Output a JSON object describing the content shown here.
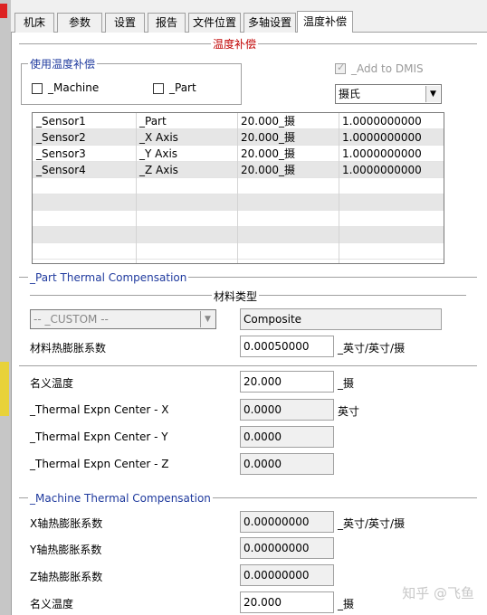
{
  "tabs": [
    {
      "label": "机床"
    },
    {
      "label": "参数"
    },
    {
      "label": "设置"
    },
    {
      "label": "报告"
    },
    {
      "label": "文件位置"
    },
    {
      "label": "多轴设置"
    },
    {
      "label": "温度补偿",
      "active": true
    }
  ],
  "header": {
    "title": "温度补偿"
  },
  "use_comp": {
    "title": "使用温度补偿",
    "machine_label": "_Machine",
    "part_label": "_Part",
    "machine_checked": false,
    "part_checked": false
  },
  "add_to_dmis": {
    "label": "_Add to DMIS",
    "checked": true,
    "disabled": true
  },
  "unit_select": {
    "value": "摄氏"
  },
  "sensors": [
    {
      "name": "_Sensor1",
      "target": "_Part",
      "temp": "20.000_摄",
      "factor": "1.0000000000"
    },
    {
      "name": "_Sensor2",
      "target": "_X Axis",
      "temp": "20.000_摄",
      "factor": "1.0000000000"
    },
    {
      "name": "_Sensor3",
      "target": "_Y Axis",
      "temp": "20.000_摄",
      "factor": "1.0000000000"
    },
    {
      "name": "_Sensor4",
      "target": "_Z Axis",
      "temp": "20.000_摄",
      "factor": "1.0000000000"
    }
  ],
  "part_comp": {
    "title": "_Part Thermal Compensation",
    "material_type_label": "材料类型",
    "material_select": "-- _CUSTOM --",
    "material_name": "Composite",
    "coef_label": "材料热膨胀系数",
    "coef_value": "0.00050000",
    "coef_unit": "_英寸/英寸/摄",
    "nominal_label": "名义温度",
    "nominal_value": "20.000",
    "nominal_unit": "_摄",
    "center_x_label": "_Thermal Expn Center - X",
    "center_x_value": "0.0000",
    "center_unit": "英寸",
    "center_y_label": "_Thermal Expn Center - Y",
    "center_y_value": "0.0000",
    "center_z_label": "_Thermal Expn Center - Z",
    "center_z_value": "0.0000"
  },
  "machine_comp": {
    "title": "_Machine Thermal Compensation",
    "x_label": "X轴热膨胀系数",
    "x_value": "0.00000000",
    "x_unit": "_英寸/英寸/摄",
    "y_label": "Y轴热膨胀系数",
    "y_value": "0.00000000",
    "z_label": "Z轴热膨胀系数",
    "z_value": "0.00000000",
    "nominal_label": "名义温度",
    "nominal_value": "20.000",
    "nominal_unit": "_摄"
  },
  "watermark": "知乎 @飞鱼",
  "colors": {
    "accent_red": "#c00000",
    "group_blue": "#1f3a9e"
  }
}
